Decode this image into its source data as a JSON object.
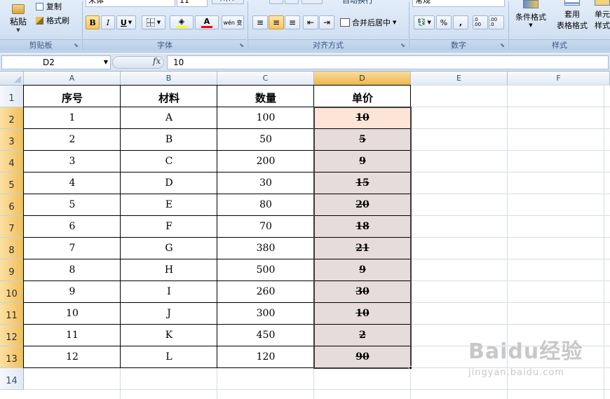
{
  "ribbon": {
    "clipboard": {
      "paste": "粘贴",
      "copy": "复制",
      "format_painter": "格式刷",
      "label": "剪贴板"
    },
    "font": {
      "font_name": "宋体",
      "font_size": "11",
      "bold": "B",
      "italic": "I",
      "underline": "U",
      "font_color": "A",
      "phonetic": "wén 变",
      "label": "字体"
    },
    "alignment": {
      "wrap_text": "自动换行",
      "merge_center": "合并后居中",
      "label": "对齐方式"
    },
    "number": {
      "format": "常规",
      "percent": "%",
      "comma": ",",
      "inc_decimal": ".0 .00",
      "dec_decimal": ".00 .0",
      "label": "数字"
    },
    "styles": {
      "conditional": "条件格式",
      "table_format_1": "套用",
      "table_format_2": "表格格式",
      "cell_styles_1": "单元",
      "cell_styles_2": "样式",
      "label": "样式"
    }
  },
  "formula_bar": {
    "name_box": "D2",
    "fx": "fx",
    "value": "10"
  },
  "sheet": {
    "columns": [
      "A",
      "B",
      "C",
      "D",
      "E",
      "F"
    ],
    "selected_column": "D",
    "rows": [
      "1",
      "2",
      "3",
      "4",
      "5",
      "6",
      "7",
      "8",
      "9",
      "10",
      "11",
      "12",
      "13",
      "14"
    ],
    "headers": [
      "序号",
      "材料",
      "数量",
      "单价"
    ],
    "data": [
      [
        "1",
        "A",
        "100",
        "10"
      ],
      [
        "2",
        "B",
        "50",
        "5"
      ],
      [
        "3",
        "C",
        "200",
        "9"
      ],
      [
        "4",
        "D",
        "30",
        "15"
      ],
      [
        "5",
        "E",
        "80",
        "20"
      ],
      [
        "6",
        "F",
        "70",
        "18"
      ],
      [
        "7",
        "G",
        "380",
        "21"
      ],
      [
        "8",
        "H",
        "500",
        "9"
      ],
      [
        "9",
        "I",
        "260",
        "30"
      ],
      [
        "10",
        "J",
        "300",
        "10"
      ],
      [
        "11",
        "K",
        "450",
        "2"
      ],
      [
        "12",
        "L",
        "120",
        "90"
      ]
    ],
    "active_cell_fill": "#fce4d6",
    "selection_fill": "#e6dcdc"
  },
  "watermark": {
    "brand": "Baidu经验",
    "url": "jingyan.baidu.com"
  }
}
